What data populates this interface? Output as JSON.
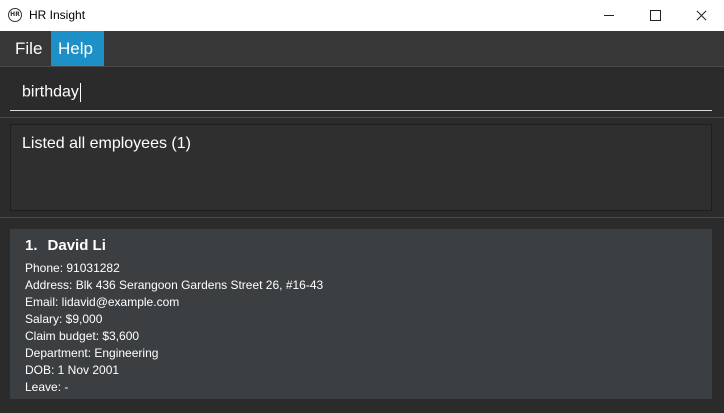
{
  "window": {
    "title": "HR Insight",
    "icon_text": "HR"
  },
  "menu": {
    "items": [
      "File",
      "Help"
    ]
  },
  "command": {
    "value": "birthday"
  },
  "result": {
    "message": "Listed all employees (1)"
  },
  "employees": [
    {
      "index": "1.",
      "name": "David Li",
      "phone": "Phone: 91031282",
      "address": "Address: Blk 436 Serangoon Gardens Street 26, #16-43",
      "email": "Email: lidavid@example.com",
      "salary": "Salary: $9,000",
      "claim_budget": "Claim budget: $3,600",
      "department": "Department: Engineering",
      "dob": "DOB: 1 Nov 2001",
      "leave": "Leave: -"
    }
  ]
}
